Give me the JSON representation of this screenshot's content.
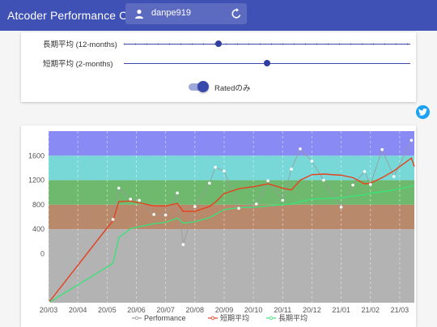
{
  "app": {
    "title": "Atcoder Performance Chart",
    "username": "danpe919"
  },
  "settings": {
    "long_label": "長期平均 (12-months)",
    "long_value_fraction": 0.33,
    "short_label": "短期平均 (2-months)",
    "short_value_fraction": 0.5,
    "toggle_label": "Ratedのみ",
    "toggle_on": true
  },
  "colors": {
    "primary": "#3f51b5",
    "twitter": "#1da1f2",
    "band_gray": "#b3b3b3",
    "band_brown": "#b8896a",
    "band_green": "#6fb96f",
    "band_cyan": "#78d8d8",
    "band_blue": "#8a8af5",
    "performance": "#999999",
    "short_avg": "#e8401c",
    "long_avg": "#3ee07a"
  },
  "icons": {
    "user": "person-icon",
    "refresh": "refresh-icon",
    "twitter": "twitter-icon"
  },
  "chart_data": {
    "type": "line",
    "y_ticks": [
      0,
      400,
      800,
      1200,
      1600
    ],
    "ylim": [
      -800,
      2000
    ],
    "x_ticks": [
      "20/03",
      "20/04",
      "20/05",
      "20/06",
      "20/07",
      "20/08",
      "20/09",
      "20/10",
      "20/11",
      "20/12",
      "21/01",
      "21/02",
      "21/03"
    ],
    "xlim_months": [
      0,
      12.5
    ],
    "bands": [
      {
        "from": -800,
        "to": 400,
        "color": "#b3b3b3"
      },
      {
        "from": 400,
        "to": 800,
        "color": "#b8896a"
      },
      {
        "from": 800,
        "to": 1200,
        "color": "#6fb96f"
      },
      {
        "from": 1200,
        "to": 1600,
        "color": "#78d8d8"
      },
      {
        "from": 1600,
        "to": 2000,
        "color": "#8a8af5"
      }
    ],
    "series": [
      {
        "name": "Performance",
        "x": [
          0.0,
          2.2,
          2.4,
          2.8,
          3.1,
          3.6,
          4.0,
          4.4,
          4.6,
          5.0,
          5.5,
          5.7,
          6.0,
          6.5,
          7.1,
          7.5,
          8.0,
          8.3,
          8.6,
          9.0,
          9.4,
          10.0,
          10.4,
          10.8,
          11.0,
          11.4,
          11.8,
          12.4
        ],
        "y": [
          -800,
          560,
          1070,
          890,
          870,
          640,
          630,
          990,
          150,
          770,
          1150,
          1410,
          1350,
          740,
          810,
          1190,
          870,
          1380,
          1710,
          1510,
          1200,
          760,
          1120,
          1340,
          1130,
          1700,
          1260,
          1850
        ]
      },
      {
        "name": "短期平均",
        "x": [
          0.0,
          2.2,
          2.4,
          2.8,
          3.1,
          3.6,
          4.0,
          4.4,
          4.6,
          5.0,
          5.5,
          5.7,
          6.0,
          6.5,
          7.1,
          7.5,
          8.0,
          8.3,
          8.6,
          9.0,
          9.4,
          10.0,
          10.4,
          10.8,
          11.0,
          11.4,
          11.8,
          12.4,
          12.5
        ],
        "y": [
          -800,
          540,
          850,
          860,
          830,
          780,
          780,
          820,
          690,
          690,
          770,
          840,
          980,
          1060,
          1100,
          1140,
          1070,
          1040,
          1200,
          1290,
          1300,
          1280,
          1240,
          1140,
          1150,
          1240,
          1350,
          1560,
          1420
        ]
      },
      {
        "name": "長期平均",
        "x": [
          0.0,
          2.2,
          2.4,
          2.8,
          3.1,
          3.6,
          4.0,
          4.4,
          4.6,
          5.0,
          5.5,
          5.7,
          6.0,
          6.5,
          7.1,
          7.5,
          8.0,
          8.3,
          8.6,
          9.0,
          9.4,
          10.0,
          10.4,
          10.8,
          11.0,
          11.4,
          11.8,
          12.4,
          12.5
        ],
        "y": [
          -800,
          -160,
          260,
          410,
          440,
          490,
          510,
          580,
          500,
          520,
          590,
          640,
          720,
          750,
          760,
          780,
          800,
          810,
          850,
          890,
          900,
          910,
          940,
          960,
          990,
          1010,
          1040,
          1100,
          1120
        ]
      }
    ],
    "legend": [
      "Performance",
      "短期平均",
      "長期平均"
    ],
    "legend_position": "bottom",
    "grid": true
  }
}
